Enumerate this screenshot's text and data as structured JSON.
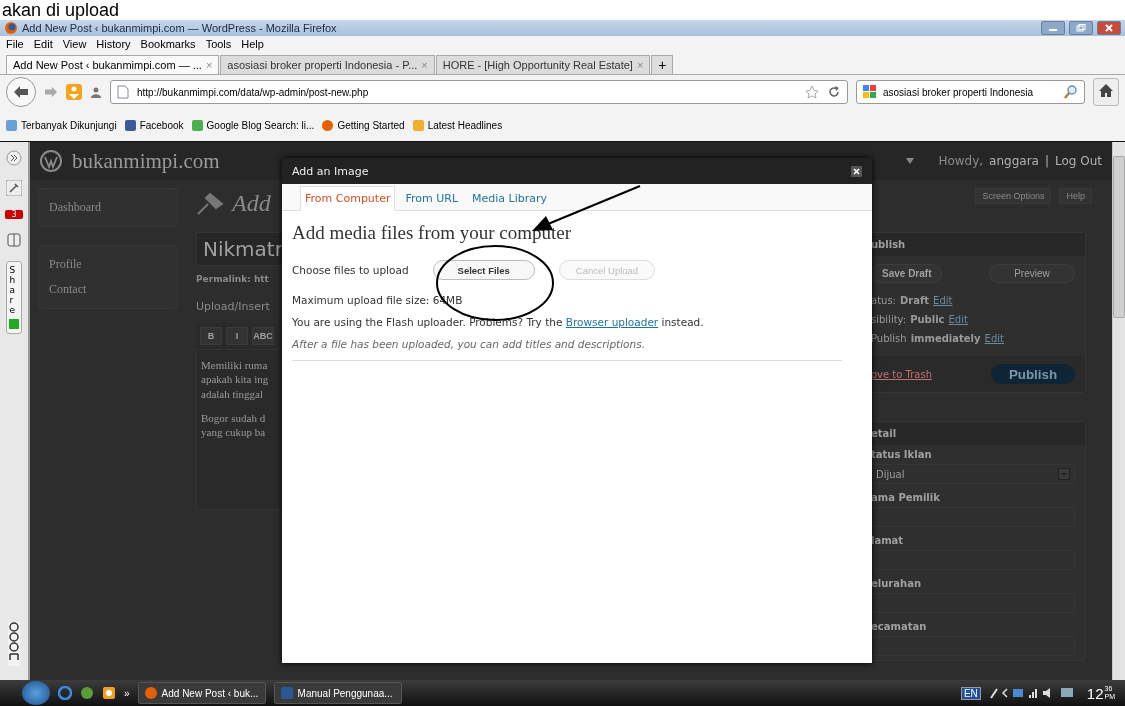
{
  "caption": "akan di upload",
  "window": {
    "title": "Add New Post ‹ bukanmimpi.com — WordPress - Mozilla Firefox"
  },
  "menu": [
    "File",
    "Edit",
    "View",
    "History",
    "Bookmarks",
    "Tools",
    "Help"
  ],
  "tabs": [
    {
      "label": "Add New Post ‹ bukanmimpi.com — ...",
      "close": "×",
      "selected": true
    },
    {
      "label": "asosiasi broker properti Indonesia - P...",
      "close": "×",
      "selected": false
    },
    {
      "label": "HORE - [High Opportunity Real Estate]",
      "close": "×",
      "selected": false
    }
  ],
  "new_tab": "+",
  "address": "http://bukanmimpi.com/data/wp-admin/post-new.php",
  "search": "asosiasi broker properti Indonesia",
  "bookmarks": [
    "Terbanyak Dikunjungi",
    "Facebook",
    "Google Blog Search: li...",
    "Getting Started",
    "Latest Headlines"
  ],
  "addon_bar": {
    "badge": "3",
    "share": "Share"
  },
  "wp": {
    "site": "bukanmimpi.com",
    "howdy": "Howdy,",
    "user": "anggara",
    "separator": "|",
    "logout": "Log Out",
    "screen_options": "Screen Options",
    "help": "Help",
    "menu": [
      "Dashboard",
      "Profile",
      "Contact"
    ],
    "page_title": "Add",
    "post_title": "Nikmatn",
    "permalink": "Permalink: htt",
    "upload_insert": "Upload/Insert",
    "toolbar": [
      "B",
      "I",
      "ABC"
    ],
    "paragraphs": [
      [
        "Memiliki ruma",
        "apakah kita ing",
        "adalah tinggal"
      ],
      [
        "Bogor sudah d",
        "yang cukup ba"
      ]
    ],
    "publish": {
      "title": "ublish",
      "save_draft": "Save Draft",
      "preview": "Preview",
      "rows": [
        {
          "label": "atus:",
          "value": "Draft",
          "link": "Edit"
        },
        {
          "label": "sibility:",
          "value": "Public",
          "link": "Edit"
        },
        {
          "label": "Publish",
          "value": "immediately",
          "link": "Edit"
        }
      ],
      "trash": "ove to Trash",
      "button": "Publish"
    },
    "detail": {
      "title": "etail",
      "fields": [
        {
          "kind": "select",
          "label": "tatus Iklan",
          "value": "Dijual"
        },
        {
          "kind": "text",
          "label": "ama Pemilik"
        },
        {
          "kind": "text",
          "label": "lamat"
        },
        {
          "kind": "text",
          "label": "elurahan"
        },
        {
          "kind": "text",
          "label": "ecamatan"
        }
      ]
    }
  },
  "modal": {
    "title": "Add an Image",
    "tabs": [
      {
        "label": "From Computer",
        "selected": true
      },
      {
        "label": "From URL",
        "selected": false
      },
      {
        "label": "Media Library",
        "selected": false
      }
    ],
    "heading": "Add media files from your computer",
    "choose": "Choose files to upload",
    "select_button": {
      "label": "Select Files",
      "disabled": false
    },
    "cancel_button": {
      "label": "Cancel Upload",
      "disabled": true
    },
    "max_size": "Maximum upload file size: 64MB",
    "flash_before": "You are using the Flash uploader. Problems? Try the",
    "flash_link": "Browser uploader",
    "flash_after": "instead.",
    "note": "After a file has been uploaded, you can add titles and descriptions."
  },
  "taskbar": {
    "more": "»",
    "tasks": [
      "Add New Post ‹ buk...",
      "Manual Penggunaa..."
    ],
    "lang": "EN",
    "hour": "12",
    "minute": "36",
    "ampm": "PM"
  }
}
